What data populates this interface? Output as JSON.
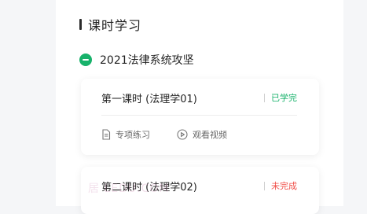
{
  "section": {
    "title": "课时学习"
  },
  "group": {
    "title": "2021法律系统攻坚"
  },
  "lessons": [
    {
      "name": "第一课时 (法理学01)",
      "status": "已学完",
      "actions": [
        {
          "icon": "document-icon",
          "label": "专项练习"
        },
        {
          "icon": "play-circle-icon",
          "label": "观看视频"
        }
      ]
    },
    {
      "name": "第二课时 (法理学02)",
      "status": "未完成"
    }
  ],
  "colors": {
    "done": "#18b26b",
    "todo": "#f0504a",
    "accent": "#18b26b"
  },
  "watermark": "居 LEDU.COM"
}
